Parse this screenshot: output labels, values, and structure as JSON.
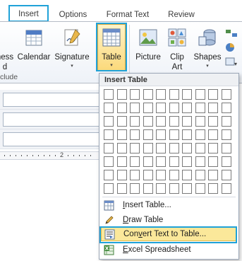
{
  "tabs": [
    {
      "label": "Insert",
      "active": true
    },
    {
      "label": "Options",
      "active": false
    },
    {
      "label": "Format Text",
      "active": false
    },
    {
      "label": "Review",
      "active": false
    }
  ],
  "ribbon": {
    "business_card": {
      "label_top": "ness",
      "label_bottom": "d",
      "arrow": "▾"
    },
    "calendar": {
      "label": "Calendar"
    },
    "signature": {
      "label": "Signature",
      "arrow": "▾"
    },
    "table": {
      "label": "Table",
      "arrow": "▾"
    },
    "picture": {
      "label": "Picture"
    },
    "clip_art": {
      "label_top": "Clip",
      "label_bottom": "Art"
    },
    "shapes": {
      "label": "Shapes",
      "arrow": "▾"
    },
    "group_label": "clude"
  },
  "ruler": {
    "mark": "2"
  },
  "dropdown": {
    "title": "Insert Table",
    "grid": {
      "cols": 10,
      "rows": 8
    },
    "items": [
      {
        "name": "insert-table-item",
        "pre": "",
        "u": "I",
        "post": "nsert Table...",
        "icon": "table-icon",
        "selected": false
      },
      {
        "name": "draw-table-item",
        "pre": "",
        "u": "D",
        "post": "raw Table",
        "icon": "pencil-icon",
        "selected": false
      },
      {
        "name": "convert-text-to-table-item",
        "pre": "Con",
        "u": "v",
        "post": "ert Text to Table...",
        "icon": "convert-icon",
        "selected": true
      },
      {
        "name": "excel-spreadsheet-item",
        "pre": "",
        "u": "E",
        "post": "xcel Spreadsheet",
        "icon": "excel-icon",
        "selected": false
      }
    ]
  },
  "colors": {
    "highlight": "#20a2d8",
    "selected": "#fbe89a"
  }
}
